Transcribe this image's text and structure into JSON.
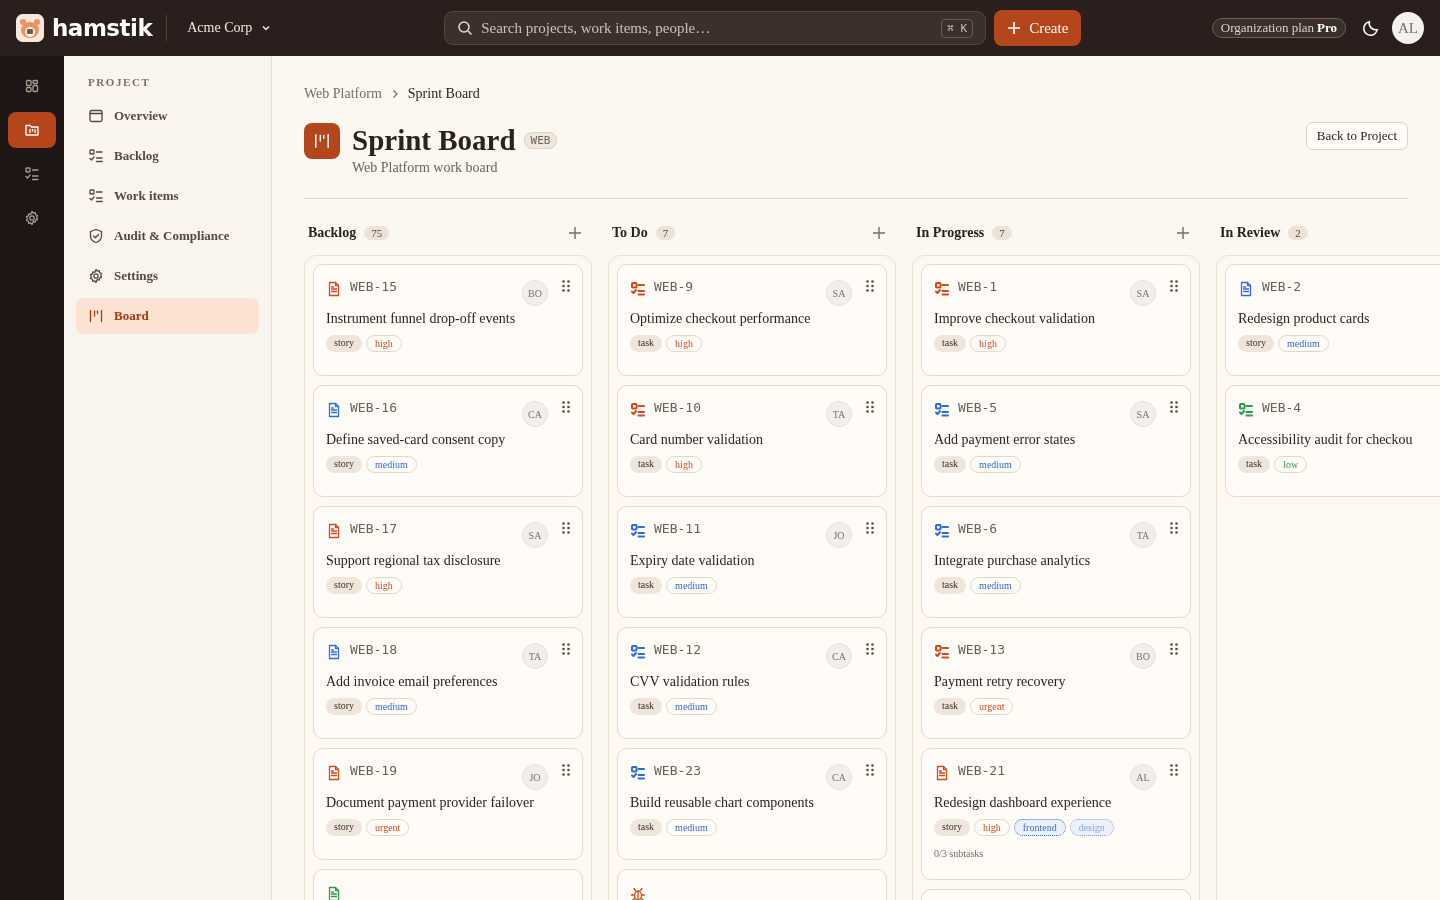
{
  "topbar": {
    "brand": "hamstik",
    "org": "Acme Corp",
    "search": {
      "placeholder": "Search projects, work items, people…",
      "shortcut": "⌘ K"
    },
    "create": "Create",
    "plan": {
      "label": "Organization plan",
      "tier": "Pro"
    },
    "avatar": "AL"
  },
  "rail": [
    {
      "kind": "grid",
      "selected": false
    },
    {
      "kind": "project",
      "selected": true
    },
    {
      "kind": "tasks",
      "selected": false
    },
    {
      "kind": "settings",
      "selected": false
    }
  ],
  "sidebar": {
    "heading": "PROJECT",
    "items": [
      {
        "label": "Overview",
        "kind": "window",
        "selected": false
      },
      {
        "label": "Backlog",
        "kind": "tasks",
        "selected": false
      },
      {
        "label": "Work items",
        "kind": "tasks",
        "selected": false
      },
      {
        "label": "Audit & Compliance",
        "kind": "shield",
        "selected": false
      },
      {
        "label": "Settings",
        "kind": "settings",
        "selected": false
      },
      {
        "label": "Board",
        "kind": "board",
        "selected": true
      }
    ]
  },
  "breadcrumb": [
    "Web Platform",
    "Sprint Board"
  ],
  "header": {
    "title": "Sprint Board",
    "badge": "WEB",
    "subtitle": "Web Platform work board",
    "back": "Back to Project"
  },
  "columns": [
    {
      "name": "Backlog",
      "count": "75",
      "addable": true,
      "cards": [
        {
          "kind": "story",
          "color": "#d4481e",
          "id": "WEB-15",
          "assignee": "BO",
          "title": "Instrument funnel drop-off events",
          "type": "story",
          "priority": "high"
        },
        {
          "kind": "story",
          "color": "#2d6cdf",
          "id": "WEB-16",
          "assignee": "CA",
          "title": "Define saved-card consent copy",
          "type": "story",
          "priority": "medium"
        },
        {
          "kind": "story",
          "color": "#d4481e",
          "id": "WEB-17",
          "assignee": "SA",
          "title": "Support regional tax disclosure",
          "type": "story",
          "priority": "high"
        },
        {
          "kind": "story",
          "color": "#2d6cdf",
          "id": "WEB-18",
          "assignee": "TA",
          "title": "Add invoice email preferences",
          "type": "story",
          "priority": "medium"
        },
        {
          "kind": "story",
          "color": "#d4481e",
          "id": "WEB-19",
          "assignee": "JO",
          "title": "Document payment provider failover",
          "type": "story",
          "priority": "urgent"
        },
        {
          "kind": "story",
          "color": "#2a9d4b"
        }
      ]
    },
    {
      "name": "To Do",
      "count": "7",
      "addable": true,
      "cards": [
        {
          "kind": "task",
          "color": "#d4481e",
          "id": "WEB-9",
          "assignee": "SA",
          "title": "Optimize checkout performance",
          "type": "task",
          "priority": "high"
        },
        {
          "kind": "task",
          "color": "#d4481e",
          "id": "WEB-10",
          "assignee": "TA",
          "title": "Card number validation",
          "type": "task",
          "priority": "high"
        },
        {
          "kind": "task",
          "color": "#2d6cdf",
          "id": "WEB-11",
          "assignee": "JO",
          "title": "Expiry date validation",
          "type": "task",
          "priority": "medium"
        },
        {
          "kind": "task",
          "color": "#2d6cdf",
          "id": "WEB-12",
          "assignee": "CA",
          "title": "CVV validation rules",
          "type": "task",
          "priority": "medium"
        },
        {
          "kind": "task",
          "color": "#2d6cdf",
          "id": "WEB-23",
          "assignee": "CA",
          "title": "Build reusable chart components",
          "type": "task",
          "priority": "medium"
        },
        {
          "kind": "bug",
          "color": "#d4481e"
        }
      ]
    },
    {
      "name": "In Progress",
      "count": "7",
      "addable": true,
      "cards": [
        {
          "kind": "task",
          "color": "#d4481e",
          "id": "WEB-1",
          "assignee": "SA",
          "title": "Improve checkout validation",
          "type": "task",
          "priority": "high"
        },
        {
          "kind": "task",
          "color": "#2d6cdf",
          "id": "WEB-5",
          "assignee": "SA",
          "title": "Add payment error states",
          "type": "task",
          "priority": "medium"
        },
        {
          "kind": "task",
          "color": "#2d6cdf",
          "id": "WEB-6",
          "assignee": "TA",
          "title": "Integrate purchase analytics",
          "type": "task",
          "priority": "medium"
        },
        {
          "kind": "task",
          "color": "#d4481e",
          "id": "WEB-13",
          "assignee": "BO",
          "title": "Payment retry recovery",
          "type": "task",
          "priority": "urgent"
        },
        {
          "kind": "story",
          "color": "#d4481e",
          "id": "WEB-21",
          "assignee": "AL",
          "title": "Redesign dashboard experience",
          "type": "story",
          "priority": "high",
          "labels": [
            {
              "text": "frontend",
              "color": "#3b6fe0"
            },
            {
              "text": "design",
              "color": "#8aa3e8"
            }
          ],
          "subtasks": "0/3 subtasks"
        },
        {
          "kind": "none"
        }
      ]
    },
    {
      "name": "In Review",
      "count": "2",
      "addable": false,
      "cards": [
        {
          "kind": "story",
          "color": "#2d6cdf",
          "id": "WEB-2",
          "title": "Redesign product cards",
          "type": "story",
          "priority": "medium"
        },
        {
          "kind": "task",
          "color": "#2a9d4b",
          "id": "WEB-4",
          "title": "Accessibility audit for checkou",
          "type": "task",
          "priority": "low"
        }
      ]
    }
  ]
}
